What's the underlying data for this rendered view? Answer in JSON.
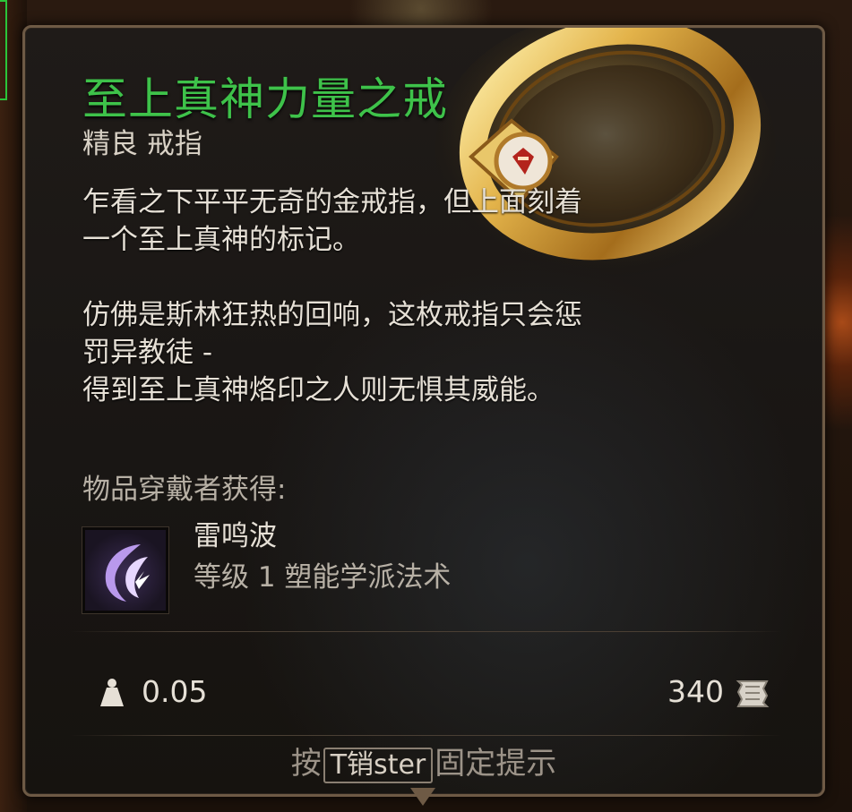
{
  "item": {
    "name": "至上真神力量之戒",
    "rarity_type": "精良 戒指",
    "description": [
      "乍看之下平平无奇的金戒指，但上面刻着",
      "一个至上真神的标记。",
      "",
      "仿佛是斯林狂热的回响，这枚戒指只会惩",
      "罚异教徒 -",
      "得到至上真神烙印之人则无惧其威能。"
    ],
    "wearer_gets_label": "物品穿戴者获得:",
    "granted_skill": {
      "name": "雷鸣波",
      "type": "等级 1 塑能学派法术",
      "icon": "thunderwave-icon"
    },
    "weight": "0.05",
    "price": "340"
  },
  "hint": {
    "prefix": "按",
    "key": "T销ster",
    "suffix": "固定提示"
  },
  "colors": {
    "title": "#3ec24a",
    "text": "#e6e0d6",
    "muted": "#b7b0a5",
    "border": "#6e5a45"
  }
}
